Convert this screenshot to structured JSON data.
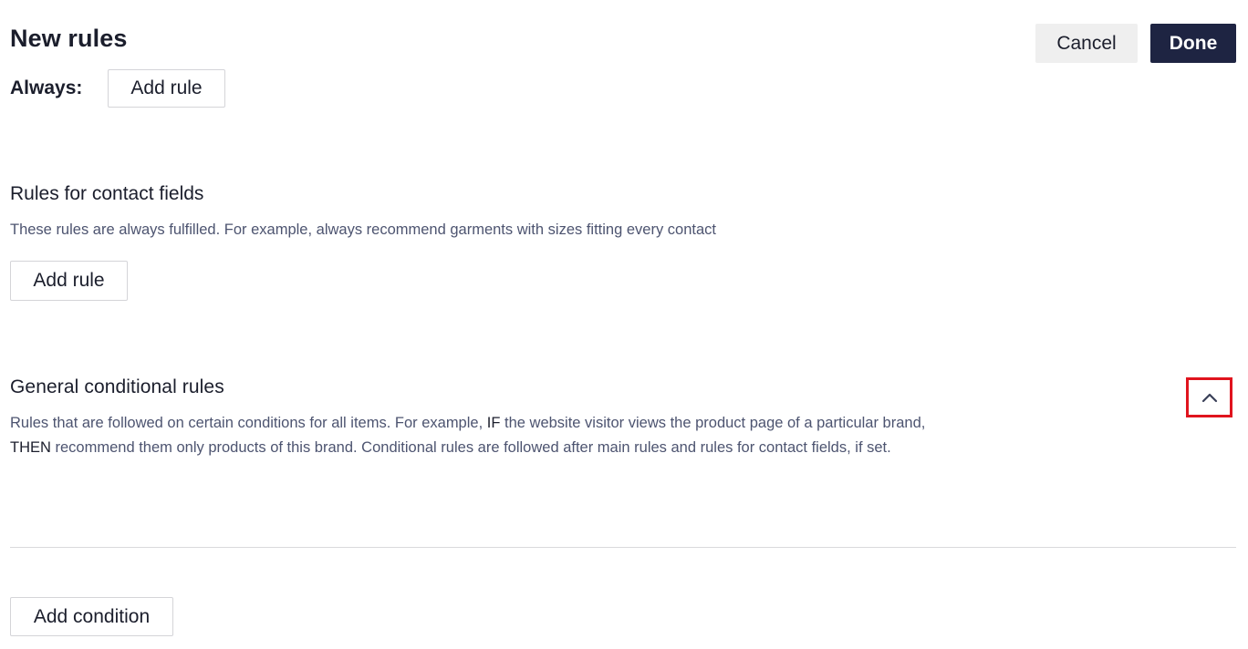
{
  "header": {
    "title": "New rules",
    "cancel_label": "Cancel",
    "done_label": "Done"
  },
  "always": {
    "label": "Always:",
    "add_rule_label": "Add rule"
  },
  "contact_rules": {
    "title": "Rules for contact fields",
    "description": "These rules are always fulfilled. For example, always recommend garments with sizes fitting every contact",
    "add_rule_label": "Add rule"
  },
  "conditional_rules": {
    "title": "General conditional rules",
    "desc_line1_part1": "Rules that are followed on certain conditions for all items. For example, ",
    "desc_keyword_if": "IF",
    "desc_line1_part2": " the website visitor views the product page of a particular brand,",
    "desc_keyword_then": "THEN",
    "desc_line2_part2": " recommend them only products of this brand. Conditional rules are followed after main rules and rules for contact fields, if set.",
    "toggle_icon": "chevron-up-icon",
    "add_condition_label": "Add condition"
  },
  "colors": {
    "primary_dark": "#1e2442",
    "highlight_border": "#e0141e",
    "muted_text": "#4d5470"
  }
}
